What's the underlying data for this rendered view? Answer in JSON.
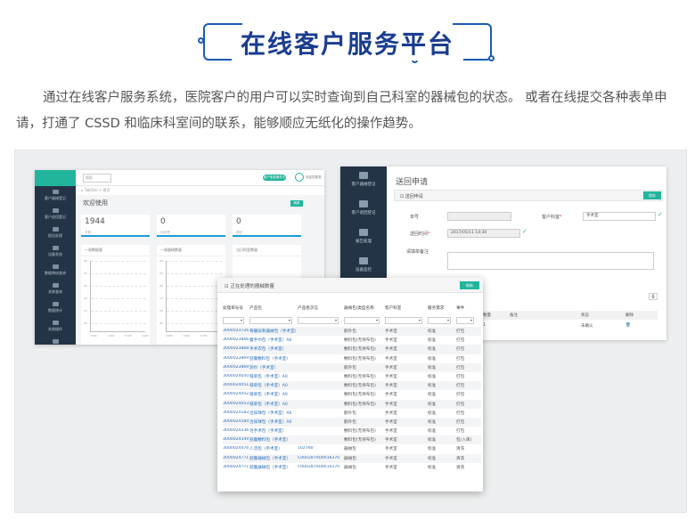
{
  "title": "在线客户服务平台",
  "intro": "通过在线客户服务系统，医院客户的用户可以实时查询到自己科室的器械包的状态。 或者在线提交各种表单申请，打通了 CSSD 和临床科室间的联系，能够顺应无纸化的操作趋势。",
  "dashboard": {
    "sidebar": [
      "客户器械登记",
      "客户退回登记",
      "报告处理",
      "设备状态",
      "数据审核查询",
      "关联查询",
      "数据统计",
      "系统操作",
      "质量中心"
    ],
    "search_placeholder": "搜索",
    "badge": "客户信息服务平台",
    "user": "欢迎您登录",
    "breadcrumb": "⌂ TabOne > 首页",
    "welcome": "欢迎使用",
    "refresh": "刷新",
    "stats": [
      {
        "num": "1944",
        "label": "总数"
      },
      {
        "num": "0",
        "label": "待处理"
      },
      {
        "num": "0",
        "label": "退回"
      }
    ],
    "panels": [
      "一周数据量",
      "一周器械数量",
      "当日科室数量"
    ],
    "yticks": [
      "30",
      "25",
      "20",
      "15",
      "10",
      "05"
    ],
    "xticks": [
      "1300",
      "1100",
      "1100",
      "1100"
    ]
  },
  "return_form": {
    "sidebar": [
      "客户器械登记",
      "客户退回登记",
      "报告处理",
      "设备监控"
    ],
    "title": "送回申请",
    "header": "⊡ 送回申请",
    "save": "保存",
    "fields": {
      "no_label": "单号",
      "dept_label": "客户科室",
      "dept_value": "手术室",
      "time_label": "送回时间",
      "time_value": "2017/05/11 14:30",
      "remark_label": "请填单备注"
    },
    "grid_headers": [
      "数量",
      "备注",
      "状态",
      "删除"
    ],
    "grid_row": [
      "1",
      "",
      "未确认",
      "🗑"
    ]
  },
  "overlay": {
    "title": "⊡ 正在处理的器械数量",
    "refresh": "刷新",
    "headers": [
      "处理单号号",
      "产品包",
      "产品批次信",
      "器械包/类型名称",
      "客户科室",
      "服务需求",
      "事件"
    ],
    "rows": [
      [
        "3000023726",
        "骨髓穿刺器械包（手术室）",
        "",
        "额外包",
        "手术室",
        "标准",
        "打包"
      ],
      [
        "3000023866",
        "腹手巾包（手术室）A0",
        "",
        "敷料包(无待布包)",
        "手术室",
        "标准",
        "打包"
      ],
      [
        "3000023868",
        "手术衣包（手术室）",
        "",
        "敷料包(无待布包)",
        "手术室",
        "标准",
        "打包"
      ],
      [
        "3000023869",
        "剖腹敷料包（手术室）",
        "",
        "敷料包(无待布包)",
        "手术室",
        "标准",
        "打包"
      ],
      [
        "3000023869",
        "洞巾（手术室）",
        "",
        "额外包",
        "手术室",
        "标准",
        "打包"
      ],
      [
        "3000024050",
        "缝单包（手术室）A0",
        "",
        "敷料包(无待布包)",
        "手术室",
        "标准",
        "打包"
      ],
      [
        "3000024051",
        "缝单包（手术室）A0",
        "",
        "敷料包(无待布包)",
        "手术室",
        "标准",
        "打包"
      ],
      [
        "3000024052",
        "缝单包（手术室）A0",
        "",
        "敷料包(无待布包)",
        "手术室",
        "标准",
        "打包"
      ],
      [
        "3000024053",
        "缝单包（手术室）A0",
        "",
        "敷料包(无待布包)",
        "手术室",
        "标准",
        "打包"
      ],
      [
        "3000024183",
        "治尿球包（手术室）A0",
        "",
        "额外包",
        "手术室",
        "标准",
        "打包"
      ],
      [
        "3000024184",
        "治尿球包（手术室）A0",
        "",
        "额外包",
        "手术室",
        "标准",
        "打包"
      ],
      [
        "3000024336",
        "治手术包（手术室）",
        "",
        "敷料包(无待布包)",
        "手术室",
        "标准",
        "打包"
      ],
      [
        "3000024349",
        "剖腹敷料包（手术室）",
        "",
        "敷料包(无待布包)",
        "手术室",
        "标准",
        "包(入库)"
      ],
      [
        "3000024476",
        "人流包（手术室）",
        "102760",
        "器械包",
        "手术室",
        "标准",
        "清洗"
      ],
      [
        "3000024771",
        "剖腹器械包（手术室）",
        "C00028TR00016370",
        "器械包",
        "手术室",
        "标准",
        "清洗"
      ],
      [
        "3000024771",
        "剖腹器械包（手术室）",
        "C00028TR00016370",
        "器械包",
        "手术室",
        "标准",
        "清洗"
      ]
    ]
  }
}
